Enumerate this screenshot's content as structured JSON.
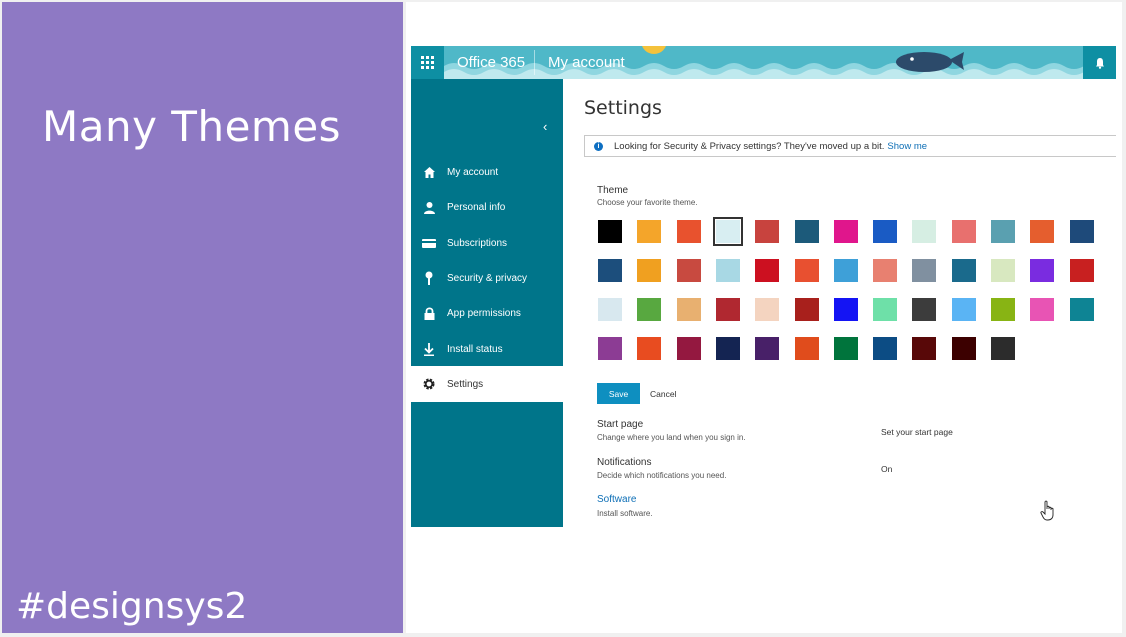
{
  "slide": {
    "title": "Many Themes",
    "hashtag": "#designsys2"
  },
  "topbar": {
    "brand": "Office 365",
    "account": "My account",
    "bell": "bell-icon"
  },
  "sidebar": {
    "collapse_icon": "chevron-left-icon",
    "items": [
      {
        "label": "My account",
        "icon": "home-icon"
      },
      {
        "label": "Personal info",
        "icon": "person-icon"
      },
      {
        "label": "Subscriptions",
        "icon": "card-icon"
      },
      {
        "label": "Security & privacy",
        "icon": "key-icon"
      },
      {
        "label": "App permissions",
        "icon": "lock-icon"
      },
      {
        "label": "Install status",
        "icon": "download-icon"
      },
      {
        "label": "Settings",
        "icon": "gear-icon",
        "active": true
      }
    ]
  },
  "settings": {
    "title": "Settings",
    "notice_text": "Looking for Security & Privacy settings? They've moved up a bit.",
    "notice_link": "Show me",
    "theme_label": "Theme",
    "theme_sub": "Choose your favorite theme.",
    "themes": [
      [
        "#000000",
        "#f4a52a",
        "#e8522e",
        "#d8eef2",
        "#c8433e",
        "#1c5a7a",
        "#e0168c",
        "#1a5bc4",
        "#d6eee3",
        "#e8706e",
        "#5aa0b0",
        "#e55e2e",
        "#1e4a7a"
      ],
      [
        "#1c4e7c",
        "#f0a020",
        "#c84a40",
        "#a8d8e4",
        "#cc1020",
        "#e85030",
        "#3ea0d8",
        "#e88070",
        "#8090a0",
        "#1a6a8c",
        "#d8e8c0",
        "#7a2ce0",
        "#c82020"
      ],
      [
        "#d8e8ef",
        "#58a840",
        "#e8b070",
        "#b02830",
        "#f4d4c0",
        "#a8201c",
        "#1414f4",
        "#6ee0a8",
        "#3c3c3c",
        "#5ab4f4",
        "#88b414",
        "#e854b4",
        "#0e8494"
      ],
      [
        "#8c3c94",
        "#e84c20",
        "#941840",
        "#142452",
        "#482068",
        "#e04c1c",
        "#00743c",
        "#0c4c84",
        "#580808",
        "#3c0000",
        "#2c2c2c"
      ]
    ],
    "selected_theme": [
      0,
      3
    ],
    "save_label": "Save",
    "cancel_label": "Cancel",
    "start_page_label": "Start page",
    "start_page_sub": "Change where you land when you sign in.",
    "start_page_value": "Set your start page",
    "notifications_label": "Notifications",
    "notifications_sub": "Decide which notifications you need.",
    "notifications_value": "On",
    "software_label": "Software",
    "software_sub": "Install software."
  }
}
